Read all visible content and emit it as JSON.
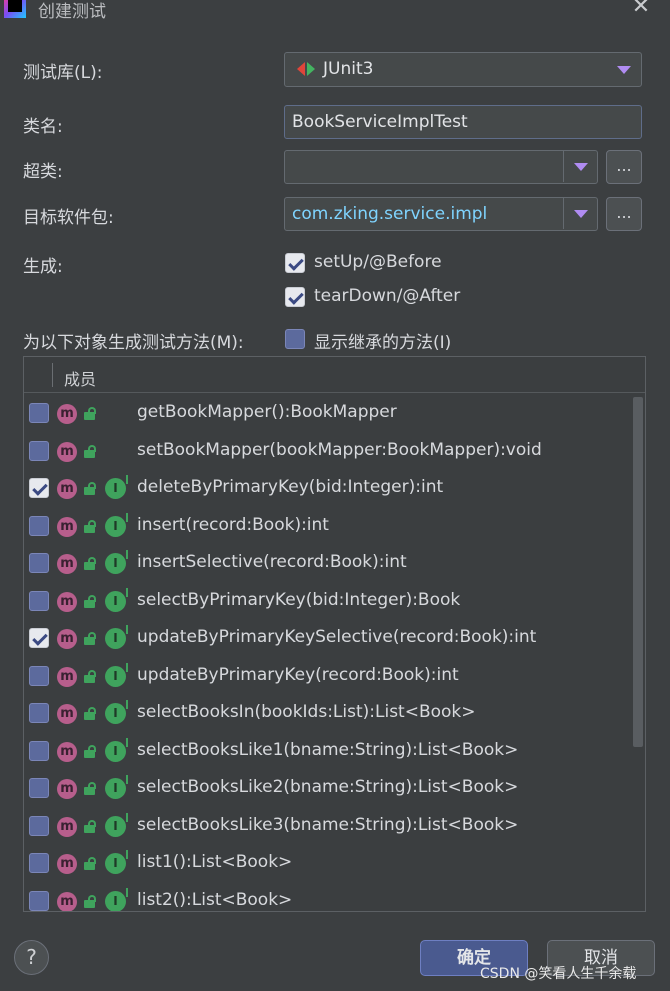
{
  "window": {
    "title": "创建测试",
    "logo_text": "IJ"
  },
  "form": {
    "test_library": {
      "label": "测试库(L):",
      "value": "JUnit3"
    },
    "class_name": {
      "label": "类名:",
      "value": "BookServiceImplTest"
    },
    "superclass": {
      "label": "超类:",
      "value": "",
      "browse": "..."
    },
    "target_package": {
      "label": "目标软件包:",
      "value": "com.zking.service.impl",
      "browse": "..."
    },
    "generate": {
      "label": "生成:",
      "options": [
        {
          "label": "setUp/@Before",
          "checked": true
        },
        {
          "label": "tearDown/@After",
          "checked": true
        }
      ]
    },
    "methods_label": "为以下对象生成测试方法(M):",
    "show_inherited": {
      "label": "显示继承的方法(I)",
      "checked": false
    }
  },
  "table": {
    "header": "成员",
    "rows": [
      {
        "checked": false,
        "implements": false,
        "signature": "getBookMapper():BookMapper"
      },
      {
        "checked": false,
        "implements": false,
        "signature": "setBookMapper(bookMapper:BookMapper):void"
      },
      {
        "checked": true,
        "implements": true,
        "signature": "deleteByPrimaryKey(bid:Integer):int"
      },
      {
        "checked": false,
        "implements": true,
        "signature": "insert(record:Book):int"
      },
      {
        "checked": false,
        "implements": true,
        "signature": "insertSelective(record:Book):int"
      },
      {
        "checked": false,
        "implements": true,
        "signature": "selectByPrimaryKey(bid:Integer):Book"
      },
      {
        "checked": true,
        "implements": true,
        "signature": "updateByPrimaryKeySelective(record:Book):int"
      },
      {
        "checked": false,
        "implements": true,
        "signature": "updateByPrimaryKey(record:Book):int"
      },
      {
        "checked": false,
        "implements": true,
        "signature": "selectBooksIn(bookIds:List):List<Book>"
      },
      {
        "checked": false,
        "implements": true,
        "signature": "selectBooksLike1(bname:String):List<Book>"
      },
      {
        "checked": false,
        "implements": true,
        "signature": "selectBooksLike2(bname:String):List<Book>"
      },
      {
        "checked": false,
        "implements": true,
        "signature": "selectBooksLike3(bname:String):List<Book>"
      },
      {
        "checked": false,
        "implements": true,
        "signature": "list1():List<Book>"
      },
      {
        "checked": false,
        "implements": true,
        "signature": "list2():List<Book>"
      }
    ],
    "method_icon_letter": "m",
    "implements_icon_letter": "I"
  },
  "footer": {
    "help": "?",
    "ok": "确定",
    "cancel": "取消",
    "watermark": "CSDN @笑看人生千余载"
  },
  "colors": {
    "background": "#3c3f41",
    "accent": "#4a5a8f",
    "method_icon": "#b75e8c",
    "public_icon": "#3fa35d",
    "link_text": "#7fd4ff"
  }
}
